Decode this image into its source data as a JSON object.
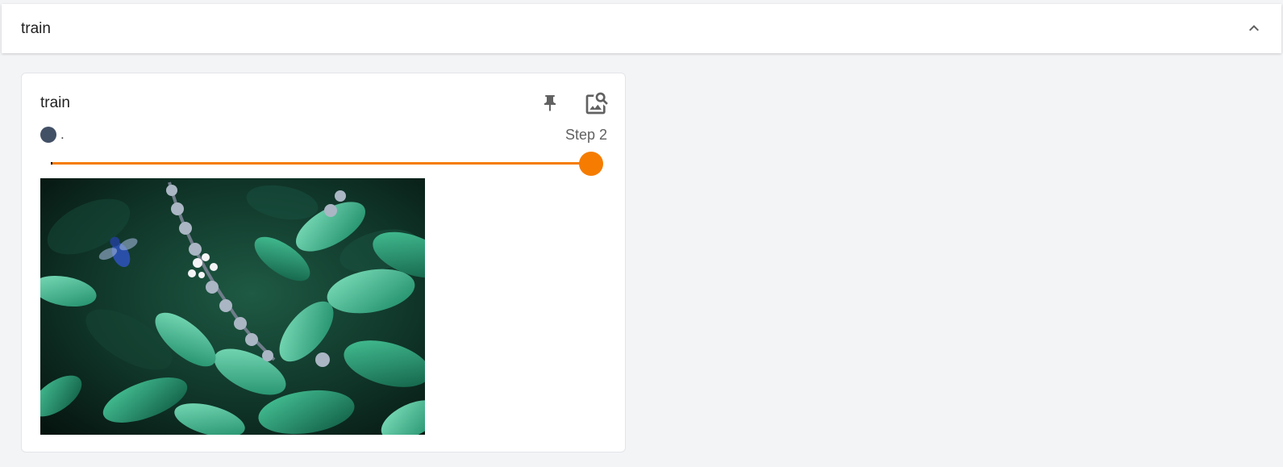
{
  "group": {
    "title": "train",
    "collapse_icon": "chevron-up-icon"
  },
  "card": {
    "title": "train",
    "pin_icon": "pin-icon",
    "view_icon": "image-search-icon",
    "run": {
      "name": ".",
      "color": "#425066"
    },
    "step_label": "Step 2",
    "slider": {
      "value_fraction": 1.0,
      "color": "#f57c00"
    }
  },
  "colors": {
    "accent": "#f57c00",
    "icon": "#616161",
    "background": "#f3f4f6"
  }
}
